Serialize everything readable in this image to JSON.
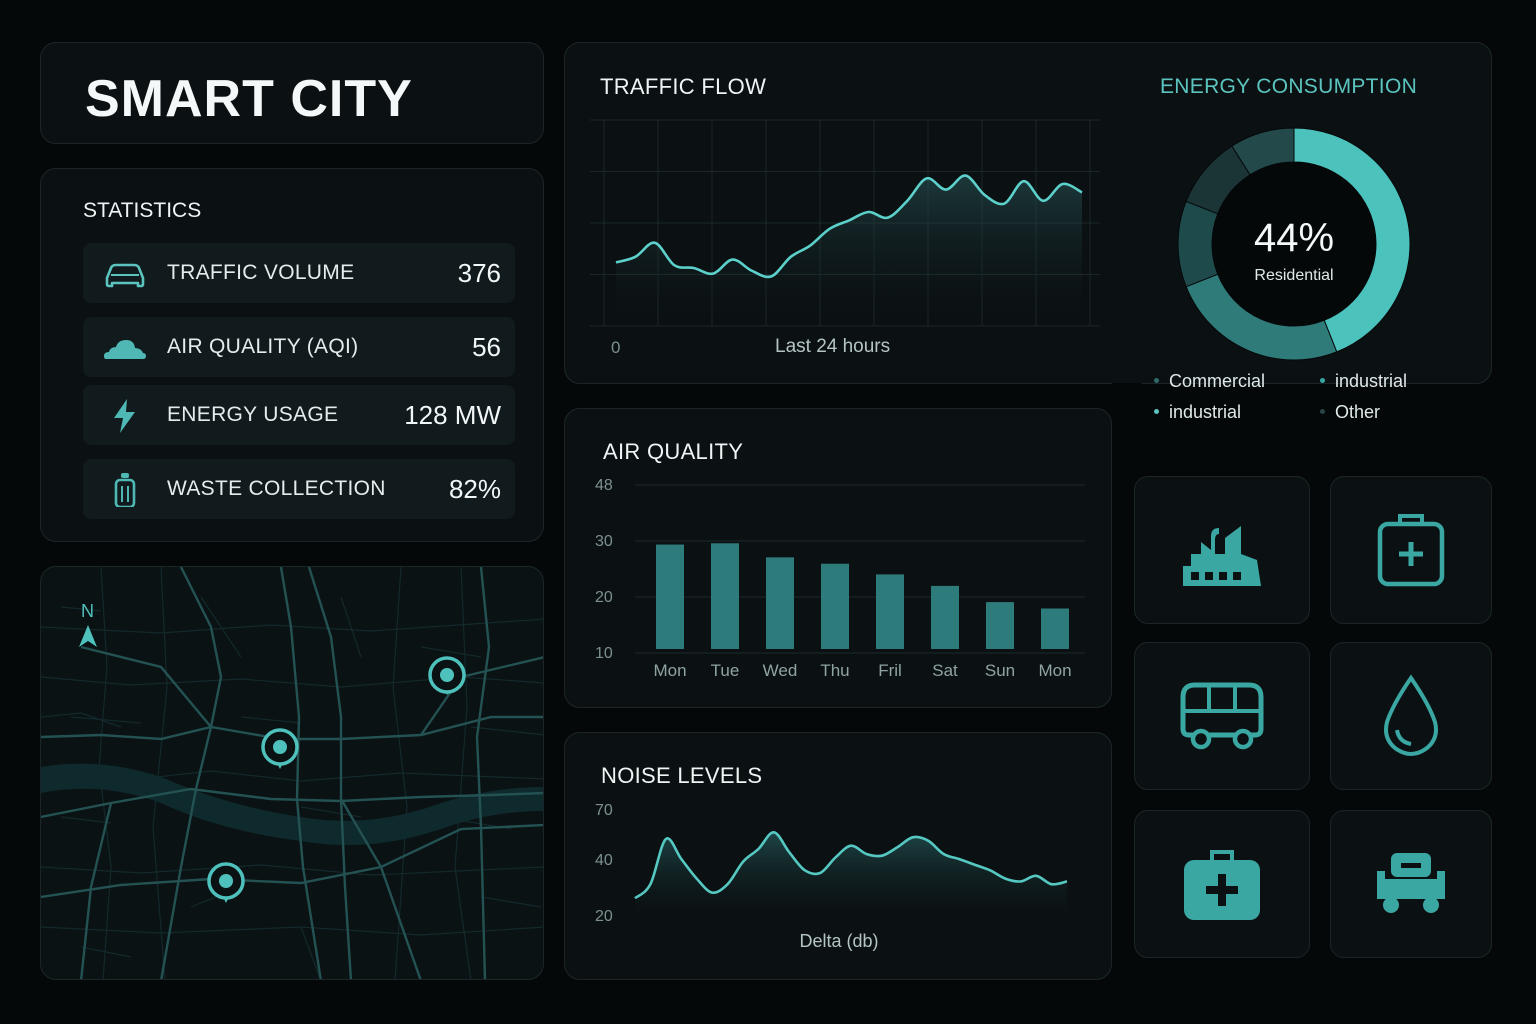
{
  "app": {
    "title": "SMART CITY"
  },
  "statistics": {
    "heading": "STATISTICS",
    "items": [
      {
        "icon": "car-icon",
        "label": "TRAFFIC VOLUME",
        "value": "376"
      },
      {
        "icon": "cloud-icon",
        "label": "AIR QUALITY (AQI)",
        "value": "56"
      },
      {
        "icon": "lightning-icon",
        "label": "ENERGY USAGE",
        "value": "128 MW"
      },
      {
        "icon": "waste-bin-icon",
        "label": "WASTE COLLECTION",
        "value": "82%"
      }
    ]
  },
  "map": {
    "compass_label": "N",
    "pin_count": 3
  },
  "traffic": {
    "title": "TRAFFIC FLOW",
    "x_start_label": "0",
    "x_caption": "Last 24 hours"
  },
  "energy": {
    "title": "ENERGY CONSUMPTION",
    "center_value": "44%",
    "center_label": "Residential",
    "legend": [
      {
        "label": "Commercial",
        "color": "#2e6a6a"
      },
      {
        "label": "industrial",
        "color": "#3aa7a3"
      },
      {
        "label": "industrial",
        "color": "#5cc4bf"
      },
      {
        "label": "Other",
        "color": "#2c4548"
      }
    ],
    "colors": {
      "residential": "#4cc2bd",
      "primary": "#2f7b7a",
      "secondary": "#1f4a4c",
      "other": "#1b3537"
    }
  },
  "air_quality": {
    "title": "AIR QUALITY"
  },
  "noise": {
    "title": "NOISE LEVELS",
    "x_caption": "Delta (db)"
  },
  "tiles": [
    {
      "icon": "factory-icon"
    },
    {
      "icon": "first-aid-kit-icon"
    },
    {
      "icon": "bus-icon"
    },
    {
      "icon": "water-drop-icon"
    },
    {
      "icon": "medical-bag-icon"
    },
    {
      "icon": "garbage-truck-icon"
    }
  ],
  "accent_color": "#4fc1bc",
  "chart_data": [
    {
      "type": "line",
      "title": "TRAFFIC FLOW",
      "xlabel": "Last 24 hours",
      "x_tick_labels": [
        "0"
      ],
      "x": [
        0,
        1,
        2,
        3,
        4,
        5,
        6,
        7,
        8,
        9,
        10,
        11,
        12,
        13,
        14,
        15,
        16,
        17,
        18,
        19,
        20,
        21,
        22,
        23,
        24
      ],
      "y": [
        12,
        14,
        19,
        11,
        10,
        8,
        13,
        9,
        7,
        14,
        18,
        24,
        27,
        30,
        28,
        34,
        42,
        38,
        43,
        36,
        33,
        41,
        34,
        40,
        37
      ],
      "grid": true
    },
    {
      "type": "bar",
      "title": "AIR QUALITY",
      "categories": [
        "Mon",
        "Tue",
        "Wed",
        "Thu",
        "Fril",
        "Sat",
        "Sun",
        "Mon"
      ],
      "values": [
        34.5,
        34.8,
        31.5,
        30.0,
        27.5,
        24.8,
        21.0,
        19.5
      ],
      "y_tick_labels": [
        "10",
        "20",
        "30",
        "48"
      ],
      "ylim": [
        10,
        48
      ]
    },
    {
      "type": "area",
      "title": "NOISE LEVELS",
      "xlabel": "Delta (db)",
      "y_tick_labels": [
        "20",
        "40",
        "70"
      ],
      "x": [
        0,
        1,
        2,
        3,
        4,
        5,
        6,
        7,
        8,
        9,
        10,
        11,
        12,
        13,
        14,
        15,
        16,
        17,
        18,
        19,
        20,
        21,
        22,
        23,
        24,
        25,
        26,
        27,
        28
      ],
      "y": [
        26,
        31,
        52,
        40,
        33,
        28,
        31,
        39,
        46,
        56,
        44,
        36,
        35,
        41,
        48,
        43,
        42,
        47,
        53,
        51,
        43,
        40,
        38,
        36,
        33,
        32,
        34,
        31,
        32
      ],
      "ylim": [
        20,
        70
      ]
    },
    {
      "type": "pie",
      "title": "ENERGY CONSUMPTION",
      "labels": [
        "Residential",
        "Commercial",
        "industrial",
        "industrial",
        "Other"
      ],
      "values": [
        44,
        25,
        12,
        10,
        9
      ]
    }
  ]
}
